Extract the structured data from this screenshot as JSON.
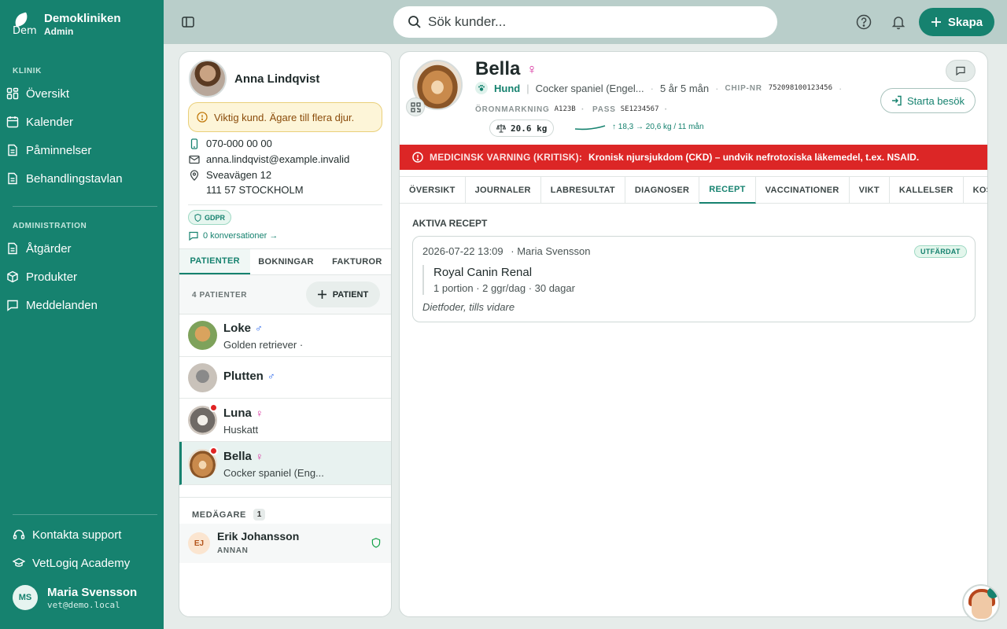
{
  "brand": {
    "name": "Demokliniken",
    "role": "Admin",
    "logo_text": "Dem"
  },
  "nav": {
    "section_klinik": "KLINIK",
    "klinik_items": [
      {
        "label": "Översikt",
        "icon": "grid-icon"
      },
      {
        "label": "Kalender",
        "icon": "calendar-icon"
      },
      {
        "label": "Påminnelser",
        "icon": "document-icon"
      },
      {
        "label": "Behandlingstavlan",
        "icon": "document-icon"
      }
    ],
    "section_admin": "ADMINISTRATION",
    "admin_items": [
      {
        "label": "Åtgärder",
        "icon": "document-icon"
      },
      {
        "label": "Produkter",
        "icon": "box-icon"
      },
      {
        "label": "Meddelanden",
        "icon": "message-icon"
      }
    ],
    "support": "Kontakta support",
    "academy": "VetLogiq Academy"
  },
  "user": {
    "initials": "MS",
    "name": "Maria Svensson",
    "email": "vet@demo.local"
  },
  "topbar": {
    "search_placeholder": "Sök kunder...",
    "create_label": "Skapa"
  },
  "owner": {
    "name": "Anna Lindqvist",
    "warning": "Viktig kund. Ägare till flera djur.",
    "phone": "070-000 00 00",
    "email": "anna.lindqvist@example.invalid",
    "street": "Sveavägen 12",
    "city": "111 57 STOCKHOLM",
    "gdpr": "GDPR",
    "conversations": "0 konversationer →"
  },
  "owner_tabs": [
    "PATIENTER",
    "BOKNINGAR",
    "FAKTUROR"
  ],
  "patients": {
    "count_label": "4 PATIENTER",
    "add_label": "PATIENT",
    "items": [
      {
        "name": "Loke",
        "sex": "♂",
        "breed": "Golden retriever ·",
        "alert": false
      },
      {
        "name": "Plutten",
        "sex": "♂",
        "breed": "",
        "alert": false
      },
      {
        "name": "Luna",
        "sex": "♀",
        "breed": "Huskatt",
        "alert": true
      },
      {
        "name": "Bella",
        "sex": "♀",
        "breed": "Cocker spaniel (Eng...",
        "alert": true
      }
    ]
  },
  "coowners": {
    "label": "MEDÄGARE",
    "count": "1",
    "items": [
      {
        "initials": "EJ",
        "name": "Erik Johansson",
        "role": "ANNAN"
      }
    ]
  },
  "pet": {
    "name": "Bella",
    "sex": "♀",
    "species": "Hund",
    "breed": "Cocker spaniel (Engel...",
    "age": "5 år 5 mån",
    "chip_label": "CHIP-NR",
    "chip": "752098100123456",
    "ear_label": "ÖRONMARKNING",
    "ear": "A123B",
    "pass_label": "PASS",
    "pass": "SE1234567",
    "weight": "20.6 kg",
    "weight_trend": "↑ 18,3 → 20,6 kg / 11 mån",
    "visit_label": "Starta besök"
  },
  "alert": {
    "label": "MEDICINSK VARNING (KRITISK):",
    "text": "Kronisk njursjukdom (CKD) – undvik nefrotoxiska läkemedel, t.ex. NSAID."
  },
  "tabs": [
    "ÖVERSIKT",
    "JOURNALER",
    "LABRESULTAT",
    "DIAGNOSER",
    "RECEPT",
    "VACCINATIONER",
    "VIKT",
    "KALLELSER",
    "KOSTNADS"
  ],
  "active_tab": "RECEPT",
  "prescriptions": {
    "title": "AKTIVA RECEPT",
    "items": [
      {
        "datetime": "2026-07-22 13:09",
        "vet": "· Maria Svensson",
        "status": "UTFÄRDAT",
        "product": "Royal Canin Renal",
        "dosage": "1 portion · 2 ggr/dag · 30 dagar",
        "note": "Dietfoder, tills vidare"
      }
    ]
  },
  "colors": {
    "brand": "#16826f",
    "alert": "#dc2626",
    "female": "#d6289a",
    "male": "#2563eb"
  }
}
